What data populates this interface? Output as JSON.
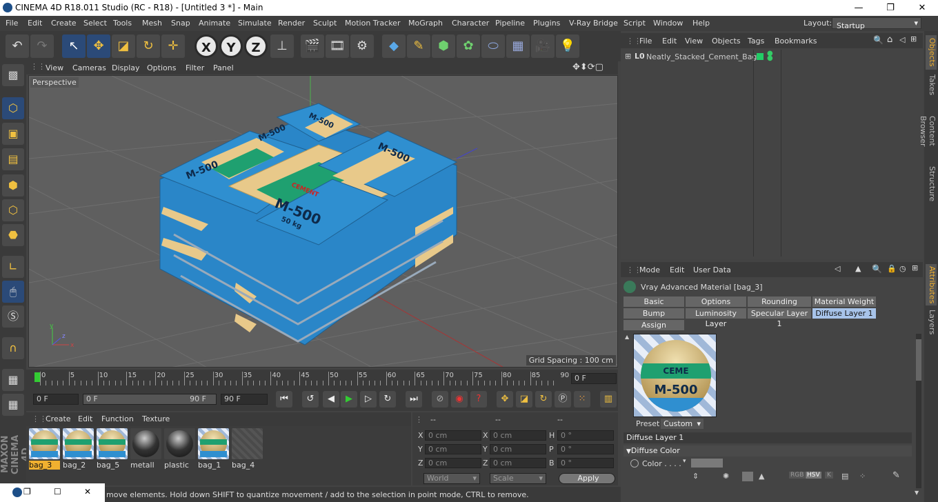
{
  "window": {
    "title": "CINEMA 4D R18.011 Studio (RC - R18) - [Untitled 3 *] - Main",
    "min": "—",
    "max": "❐",
    "close": "✕"
  },
  "menu": [
    "File",
    "Edit",
    "Create",
    "Select",
    "Tools",
    "Mesh",
    "Snap",
    "Animate",
    "Simulate",
    "Render",
    "Sculpt",
    "Motion Tracker",
    "MoGraph",
    "Character",
    "Pipeline",
    "Plugins",
    "V-Ray Bridge",
    "Script",
    "Window",
    "Help"
  ],
  "layout": {
    "label": "Layout:",
    "value": "Startup"
  },
  "viewport_menu": [
    "View",
    "Cameras",
    "Display",
    "Options",
    "Filter",
    "Panel"
  ],
  "viewport": {
    "camera": "Perspective",
    "grid_spacing": "Grid Spacing : 100 cm"
  },
  "timeline": {
    "ticks": [
      "0",
      "5",
      "10",
      "15",
      "20",
      "25",
      "30",
      "35",
      "40",
      "45",
      "50",
      "55",
      "60",
      "65",
      "70",
      "75",
      "80",
      "85",
      "90"
    ],
    "current_frame": "0 F"
  },
  "playbar": {
    "start": "0 F",
    "range_start": "0 F",
    "range_end": "90 F",
    "end": "90 F"
  },
  "material_menu": [
    "Create",
    "Edit",
    "Function",
    "Texture"
  ],
  "materials": [
    {
      "name": "bag_3",
      "kind": "bag",
      "selected": true
    },
    {
      "name": "bag_2",
      "kind": "bag"
    },
    {
      "name": "bag_5",
      "kind": "bag"
    },
    {
      "name": "metall",
      "kind": "dark"
    },
    {
      "name": "plastic",
      "kind": "dark"
    },
    {
      "name": "bag_1",
      "kind": "bag"
    },
    {
      "name": "bag_4",
      "kind": "empty"
    }
  ],
  "coords": {
    "header": [
      "--",
      "--",
      "--"
    ],
    "rows": [
      {
        "a": "X",
        "av": "0 cm",
        "b": "X",
        "bv": "0 cm",
        "c": "H",
        "cv": "0 °"
      },
      {
        "a": "Y",
        "av": "0 cm",
        "b": "Y",
        "bv": "0 cm",
        "c": "P",
        "cv": "0 °"
      },
      {
        "a": "Z",
        "av": "0 cm",
        "b": "Z",
        "bv": "0 cm",
        "c": "B",
        "cv": "0 °"
      }
    ],
    "space": "World",
    "mode": "Scale",
    "apply": "Apply"
  },
  "status": "Move: Click and drag to move elements. Hold down SHIFT to quantize movement / add to the selection in point mode, CTRL to remove.",
  "status_visible": "move elements. Hold down SHIFT to quantize movement / add to the selection in point mode, CTRL to remove.",
  "objects_menu": [
    "File",
    "Edit",
    "View",
    "Objects",
    "Tags",
    "Bookmarks"
  ],
  "objects": [
    {
      "name": "Neatly_Stacked_Cement_Bags"
    }
  ],
  "attributes_menu": [
    "Mode",
    "Edit",
    "User Data"
  ],
  "attributes": {
    "material_title": "Vray Advanced Material [bag_3]",
    "tabs_row1": [
      "Basic",
      "Options",
      "Rounding",
      "Material Weight"
    ],
    "tabs_row2": [
      "Bump",
      "Luminosity Layer",
      "Specular Layer 1",
      "Diffuse Layer 1"
    ],
    "tabs_row3": [
      "Assign"
    ],
    "selected_tab": "Diffuse Layer 1",
    "preview_text_top": "CEME",
    "preview_text_main": "M-500",
    "preset_label": "Preset",
    "preset_value": "Custom",
    "section": "Diffuse Layer 1",
    "subsection": "Diffuse Color",
    "color_label": "Color . . . .",
    "color_modes": [
      "RGB",
      "HSV",
      "K"
    ]
  },
  "side_tabs": [
    "Objects",
    "Takes",
    "Content Browser",
    "Structure",
    "Attributes",
    "Layers"
  ],
  "bag_labels": {
    "brand": "M-500",
    "weight": "50 kg",
    "product": "CEMENT"
  },
  "colors": {
    "accent": "#f0b030",
    "selected_tab": "#a7c3e9",
    "bag_blue": "#2f8fd0",
    "bag_paper": "#e8c98a",
    "bag_green": "#1fa070"
  }
}
